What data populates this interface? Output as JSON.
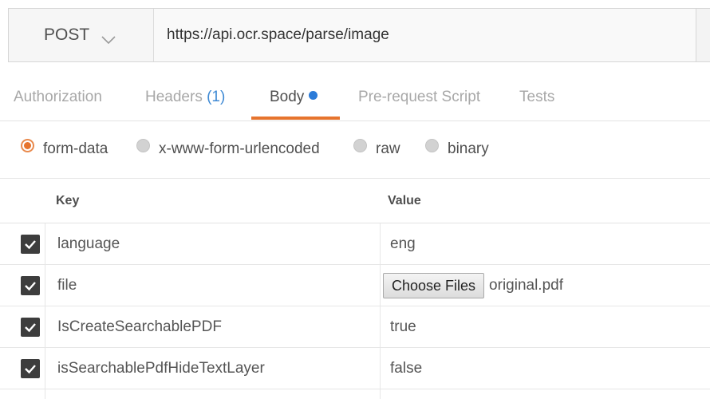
{
  "request": {
    "method": "POST",
    "url": "https://api.ocr.space/parse/image"
  },
  "tabs": [
    {
      "label": "Authorization",
      "active": false
    },
    {
      "label": "Headers",
      "count": "(1)",
      "active": false
    },
    {
      "label": "Body",
      "active": true,
      "indicator": "blue-dot"
    },
    {
      "label": "Pre-request Script",
      "active": false
    },
    {
      "label": "Tests",
      "active": false
    }
  ],
  "body_types": [
    {
      "label": "form-data",
      "checked": true
    },
    {
      "label": "x-www-form-urlencoded",
      "checked": false
    },
    {
      "label": "raw",
      "checked": false
    },
    {
      "label": "binary",
      "checked": false
    }
  ],
  "table": {
    "headers": {
      "key": "Key",
      "value": "Value"
    },
    "rows": [
      {
        "checked": true,
        "key": "language",
        "value": "eng"
      },
      {
        "checked": true,
        "key": "file",
        "file_button": "Choose Files",
        "file_name": "original.pdf"
      },
      {
        "checked": true,
        "key": "IsCreateSearchablePDF",
        "value": "true"
      },
      {
        "checked": true,
        "key": "isSearchablePdfHideTextLayer",
        "value": "false"
      }
    ]
  },
  "colors": {
    "accent_orange": "#e6742e",
    "indicator_blue": "#2b7bd8",
    "checkbox_dark": "#3d3d3d"
  },
  "icons": {
    "method_dropdown": "chevron-down-icon",
    "checkbox": "checkmark-icon"
  }
}
